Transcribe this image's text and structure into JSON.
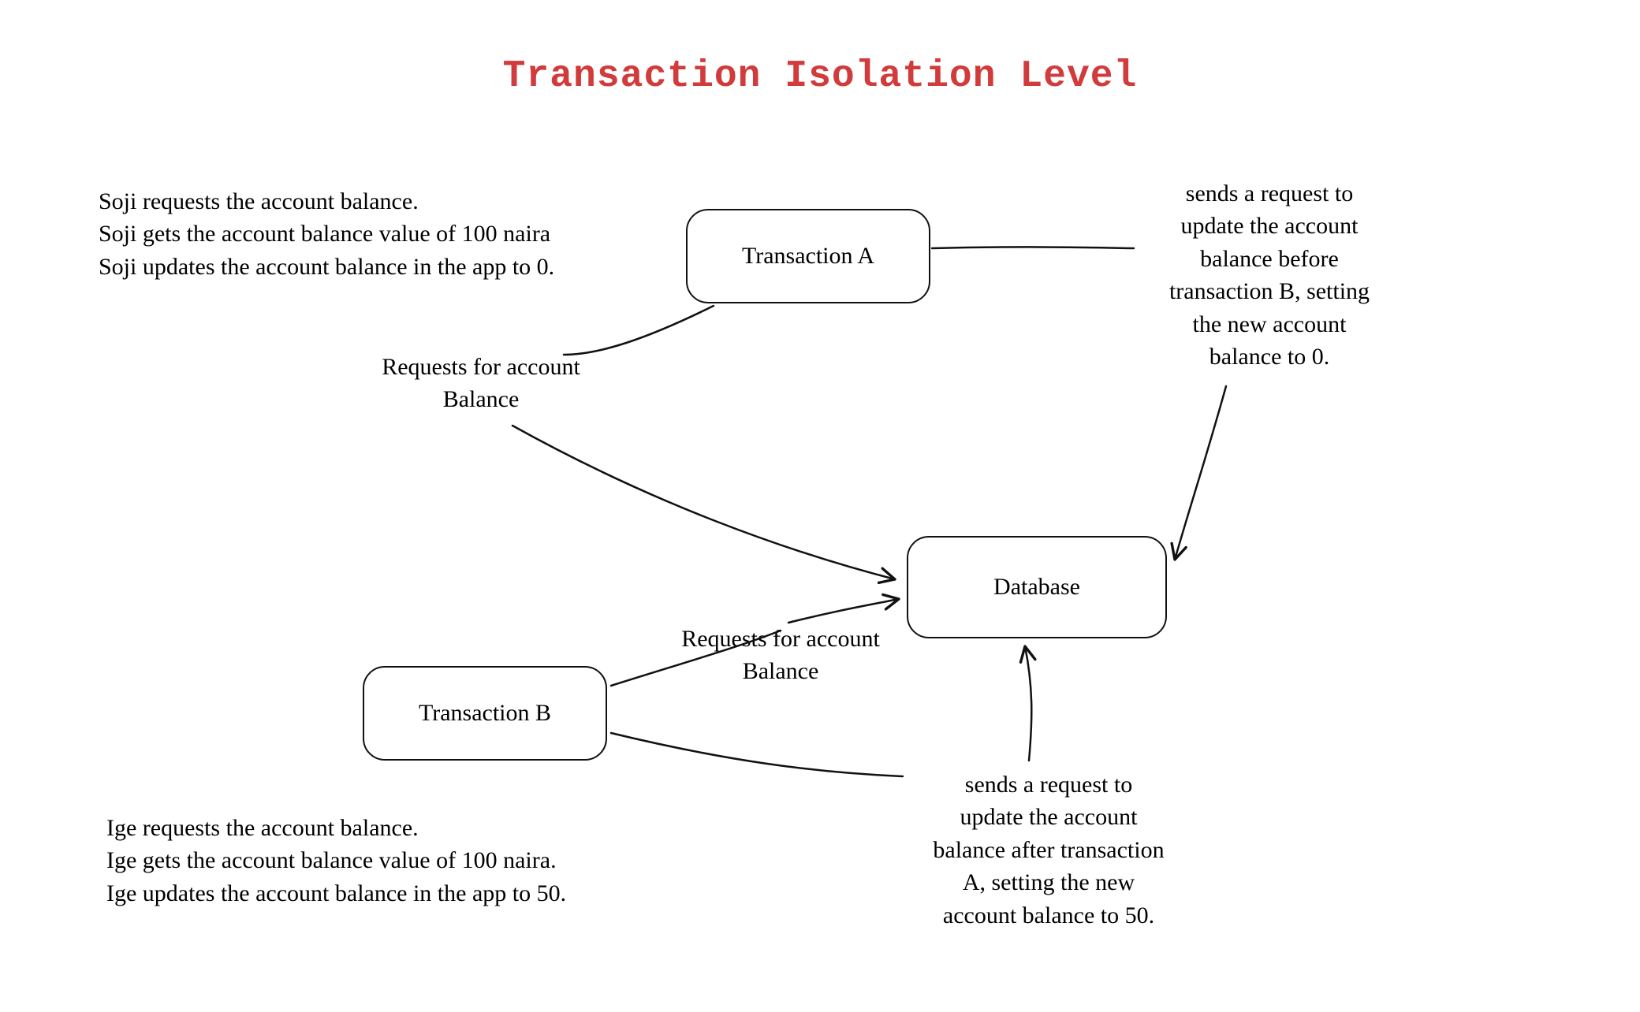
{
  "title": "Transaction Isolation Level",
  "nodes": {
    "transactionA": "Transaction A",
    "transactionB": "Transaction B",
    "database": "Database"
  },
  "narrationA": "Soji requests the account balance.\nSoji gets the account balance value of 100 naira\nSoji updates the account balance in the app to 0.",
  "narrationB": "Ige requests the account balance.\nIge gets the account balance value of 100 naira.\nIge updates the account balance in the app to 50.",
  "edgeLabels": {
    "requestA": "Requests for account\nBalance",
    "requestB": "Requests for account\nBalance",
    "updateA": "sends a request to\nupdate the account\nbalance before\ntransaction B, setting\nthe new account\nbalance to 0.",
    "updateB": "sends a request to\nupdate the account\nbalance after transaction\nA, setting the new\naccount balance to 50."
  }
}
